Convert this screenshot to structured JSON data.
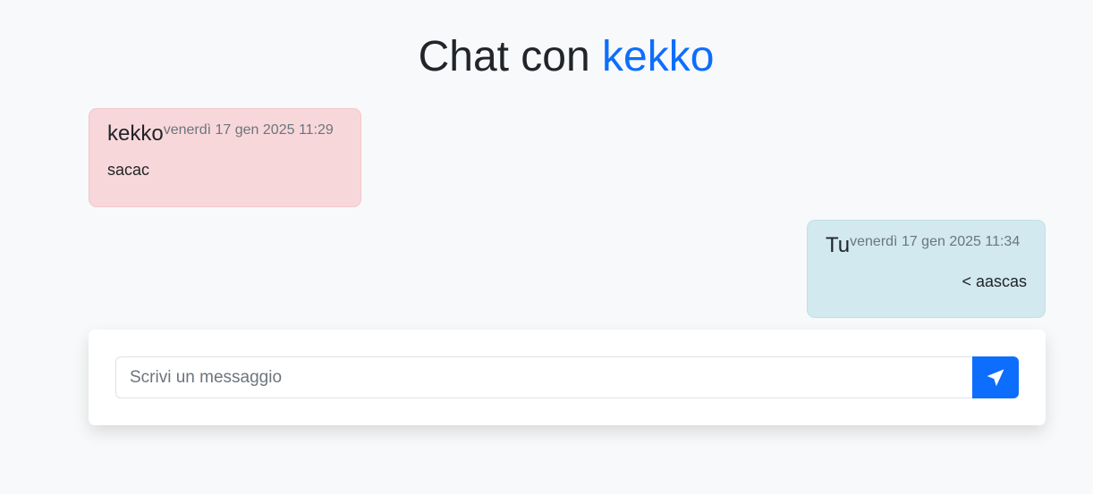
{
  "header": {
    "title_prefix": "Chat con ",
    "contact_name": "kekko"
  },
  "messages": [
    {
      "direction": "received",
      "sender": "kekko",
      "time": "venerdì 17 gen 2025 11:29",
      "text": "sacac"
    },
    {
      "direction": "sent",
      "sender": "Tu",
      "time": "venerdì 17 gen 2025 11:34",
      "text": "< aascas"
    }
  ],
  "composer": {
    "placeholder": "Scrivi un messaggio",
    "value": "",
    "send_icon": "send-arrow-icon"
  },
  "colors": {
    "accent": "#0d6efd",
    "received_bubble": "#f8d7da",
    "sent_bubble": "#d1e9ef",
    "background": "#f8f9fa"
  }
}
